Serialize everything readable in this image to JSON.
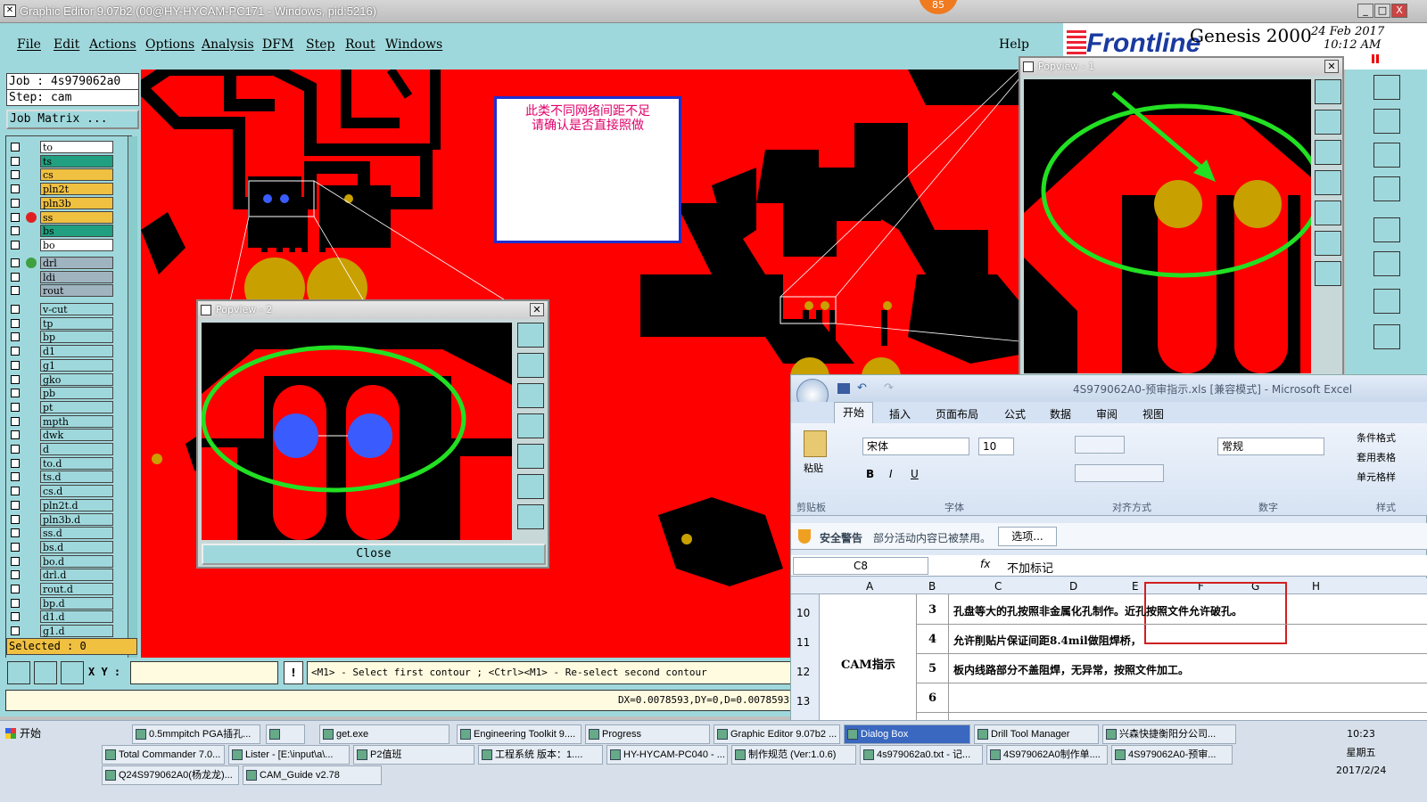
{
  "window": {
    "title": "Graphic Editor 9.07b2 (00@HY-HYCAM-PC171 - Windows, pid:5216)",
    "badge": "85",
    "controls": [
      "_",
      "□",
      "X"
    ]
  },
  "menu": {
    "items": [
      "File",
      "Edit",
      "Actions",
      "Options",
      "Analysis",
      "DFM",
      "Step",
      "Rout",
      "Windows"
    ],
    "help": "Help"
  },
  "brand": {
    "logo": "Frontline",
    "product": "Genesis 2000",
    "date": "24 Feb 2017",
    "time": "10:12 AM"
  },
  "job": {
    "job_label": "Job : 4s979062a0",
    "step_label": "Step: cam",
    "matrix_button": "Job Matrix ..."
  },
  "layers_group1": [
    {
      "name": "to",
      "color": "#ffffff"
    },
    {
      "name": "ts",
      "color": "#20a080"
    },
    {
      "name": "cs",
      "color": "#f0c040"
    },
    {
      "name": "pln2t",
      "color": "#f0c040"
    },
    {
      "name": "pln3b",
      "color": "#f0c040"
    },
    {
      "name": "ss",
      "color": "#f0c040"
    },
    {
      "name": "bs",
      "color": "#20a080"
    },
    {
      "name": "bo",
      "color": "#ffffff"
    }
  ],
  "layers_group2": [
    {
      "name": "drl",
      "color": "#a0b4c0"
    },
    {
      "name": "ldi",
      "color": "#a0b4c0"
    },
    {
      "name": "rout",
      "color": "#a0b4c0"
    }
  ],
  "layers_group3": [
    "v-cut",
    "tp",
    "bp",
    "d1",
    "g1",
    "gko",
    "pb",
    "pt",
    "mpth",
    "dwk",
    "d",
    "to.d",
    "ts.d",
    "cs.d",
    "pln2t.d",
    "pln3b.d",
    "ss.d",
    "bs.d",
    "bo.d",
    "drl.d",
    "rout.d",
    "bp.d",
    "d1.d",
    "g1.d"
  ],
  "selected_label": "Selected : 0",
  "command": {
    "xy_label": "X Y :",
    "xy_value": "",
    "prompt": "<M1> - Select first contour ; <Ctrl><M1> - Re-select second contour",
    "status": "DX=0.0078593,DY=0,D=0.0078593"
  },
  "note": {
    "line1": "此类不同网络间距不足",
    "line2": "请确认是否直接照做"
  },
  "popview1": {
    "title": "Popview - 1"
  },
  "popview2": {
    "title": "Popview - 2",
    "close": "Close"
  },
  "excel": {
    "title": "4S979062A0-预审指示.xls [兼容模式] - Microsoft Excel",
    "tabs": [
      "开始",
      "插入",
      "页面布局",
      "公式",
      "数据",
      "审阅",
      "视图"
    ],
    "font_name": "宋体",
    "font_size": "10",
    "number_format": "常规",
    "paste": "粘贴",
    "groups": [
      "剪贴板",
      "字体",
      "对齐方式",
      "数字",
      "样式"
    ],
    "styles": [
      "条件格式",
      "套用表格",
      "单元格样"
    ],
    "security_title": "安全警告",
    "security_text": "部分活动内容已被禁用。",
    "options_button": "选项...",
    "name_box": "C8",
    "formula": "不加标记",
    "columns": [
      "A",
      "B",
      "C",
      "D",
      "E",
      "F",
      "G",
      "H"
    ],
    "rows": [
      {
        "num": "10",
        "b": "3",
        "text": "孔盘等大的孔按照非金属化孔制作。近孔按照文件允许破孔。"
      },
      {
        "num": "11",
        "b": "4",
        "text": "允许削贴片保证间距8.4mil做阻焊桥，"
      },
      {
        "num": "12",
        "b": "5",
        "text": "板内线路部分不盖阻焊，无异常，按照文件加工。"
      },
      {
        "num": "13",
        "b": "6",
        "text": ""
      }
    ],
    "merged_a": "CAM指示"
  },
  "taskbar": {
    "start": "开始",
    "row1": [
      "0.5mmpitch PGA插孔...",
      "",
      "get.exe",
      "Engineering Toolkit 9....",
      "Progress",
      "Graphic Editor 9.07b2 ...",
      "Dialog Box",
      "Drill Tool Manager",
      "兴森快捷衡阳分公司..."
    ],
    "row2": [
      "Total Commander 7.0...",
      "Lister - [E:\\input\\a\\...",
      "P2值班",
      "工程系统  版本：1....",
      "HY-HYCAM-PC040 - ...",
      "制作规范 (Ver:1.0.6)",
      "4s979062a0.txt - 记...",
      "4S979062A0制作单....",
      "4S979062A0-预审..."
    ],
    "row3": [
      "Q24S979062A0(杨龙龙)...",
      "CAM_Guide v2.78"
    ],
    "clock_time": "10:23",
    "clock_day": "星期五",
    "clock_date": "2017/2/24"
  }
}
